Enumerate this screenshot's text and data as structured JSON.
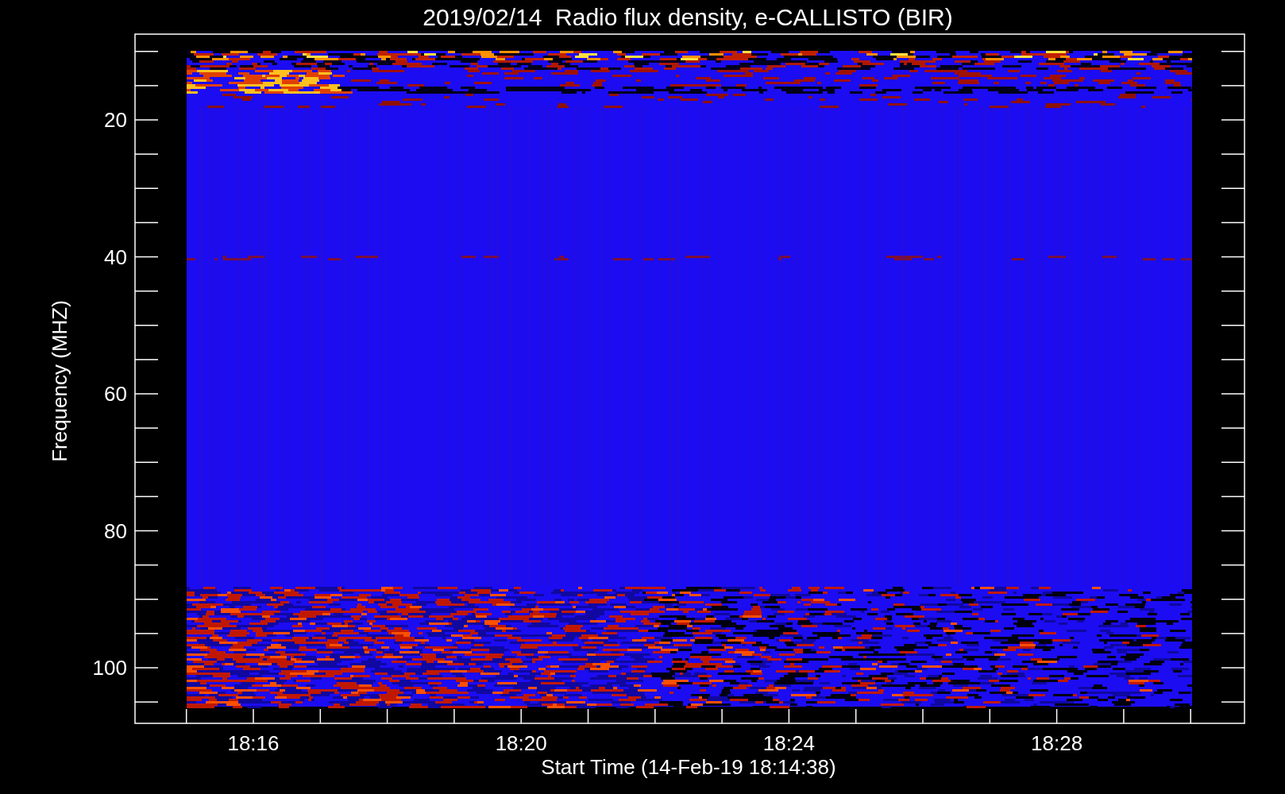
{
  "plot": {
    "title": "2019/02/14  Radio flux density, e-CALLISTO (BIR)",
    "xlabel": "Start Time (14-Feb-19 18:14:38)",
    "ylabel": "Frequency (MHZ)",
    "xticks": [
      "18:16",
      "18:20",
      "18:24",
      "18:28"
    ],
    "yticks": [
      "20",
      "40",
      "60",
      "80",
      "100"
    ]
  }
}
